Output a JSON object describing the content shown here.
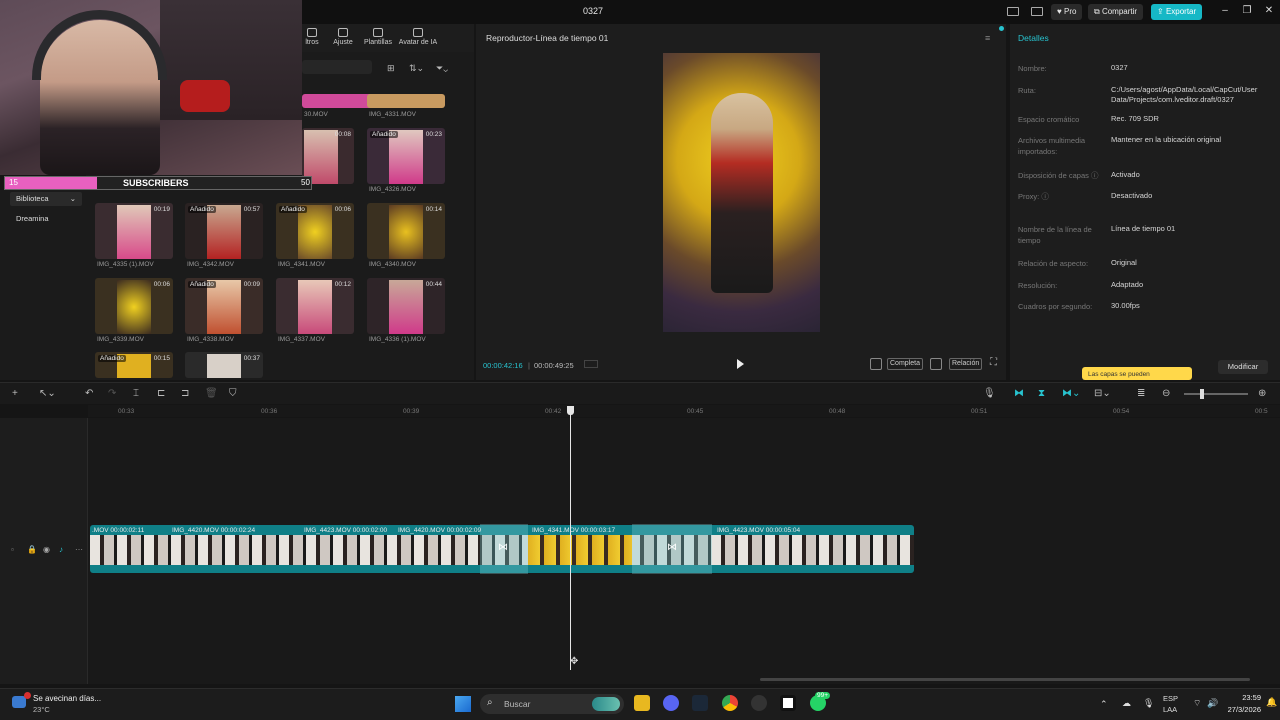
{
  "window": {
    "title": "0327",
    "pro_label": "Pro",
    "share_label": "Compartir",
    "export_label": "Exportar"
  },
  "overlay": {
    "left_count": "15",
    "label": "SUBSCRIBERS",
    "right_count": "50",
    "progress": 0.3
  },
  "media": {
    "tabs": [
      "ltros",
      "Ajuste",
      "Plantillas",
      "Avatar de IA"
    ],
    "nav": [
      "Biblioteca",
      "Dreamina"
    ],
    "clips": [
      {
        "name": "30.MOV",
        "dur": "",
        "added": ""
      },
      {
        "name": "IMG_4331.MOV",
        "dur": "",
        "added": ""
      },
      {
        "name": "",
        "dur": "00:08",
        "added": ""
      },
      {
        "name": "IMG_4326.MOV",
        "dur": "00:23",
        "added": "Añadido"
      },
      {
        "name": "IMG_4335 (1).MOV",
        "dur": "00:19",
        "added": ""
      },
      {
        "name": "IMG_4342.MOV",
        "dur": "00:57",
        "added": "Añadido"
      },
      {
        "name": "IMG_4341.MOV",
        "dur": "00:06",
        "added": "Añadido"
      },
      {
        "name": "IMG_4340.MOV",
        "dur": "00:14",
        "added": ""
      },
      {
        "name": "IMG_4339.MOV",
        "dur": "00:06",
        "added": ""
      },
      {
        "name": "IMG_4338.MOV",
        "dur": "00:09",
        "added": "Añadido"
      },
      {
        "name": "IMG_4337.MOV",
        "dur": "00:12",
        "added": ""
      },
      {
        "name": "IMG_4336 (1).MOV",
        "dur": "00:44",
        "added": ""
      },
      {
        "name": "",
        "dur": "00:15",
        "added": "Añadido"
      },
      {
        "name": "",
        "dur": "00:37",
        "added": ""
      }
    ]
  },
  "player": {
    "title": "Reproductor-Línea de tiempo 01",
    "current": "00:00:42:16",
    "total": "00:00:49:25",
    "btn1": "Completa",
    "btn2": "Relación"
  },
  "details": {
    "title": "Detalles",
    "rows": [
      {
        "k": "Nombre:",
        "v": "0327"
      },
      {
        "k": "Ruta:",
        "v": "C:/Users/agost/AppData/Local/CapCut/User Data/Projects/com.lveditor.draft/0327"
      },
      {
        "k": "Espacio cromático",
        "v": "Rec. 709 SDR"
      },
      {
        "k": "Archivos multimedia importados:",
        "v": "Mantener en la ubicación original"
      },
      {
        "k": "Disposición de capas ⓘ",
        "v": "Activado"
      },
      {
        "k": "Proxy: ⓘ",
        "v": "Desactivado"
      },
      {
        "k": "Nombre de la línea de tiempo",
        "v": "Línea de tiempo 01"
      },
      {
        "k": "Relación de aspecto:",
        "v": "Original"
      },
      {
        "k": "Resolución:",
        "v": "Adaptado"
      },
      {
        "k": "Cuadros por segundo:",
        "v": "30.00fps"
      }
    ],
    "toast": "Las capas se pueden",
    "modify": "Modificar"
  },
  "timeline": {
    "ticks": [
      "00:33",
      "00:36",
      "00:39",
      "00:42",
      "00:45",
      "00:48",
      "00:51",
      "00:54",
      "00:5"
    ],
    "clips": [
      {
        "label": ".MOV  00:00:02:11"
      },
      {
        "label": "IMG_4420.MOV  00:00:02:24"
      },
      {
        "label": "IMG_4423.MOV  00:00:02:00"
      },
      {
        "label": "IMG_4420.MOV  00:00:02:09"
      },
      {
        "label": "IMG_4341.MOV  00:00:03:17"
      },
      {
        "label": "IMG_4423.MOV  00:00:05:04"
      }
    ]
  },
  "taskbar": {
    "weather_title": "Se avecinan días...",
    "weather_temp": "23°C",
    "search": "Buscar",
    "lang1": "ESP",
    "lang2": "LAA",
    "time": "23:59",
    "date": "27/3/2026",
    "badge": "99+"
  }
}
